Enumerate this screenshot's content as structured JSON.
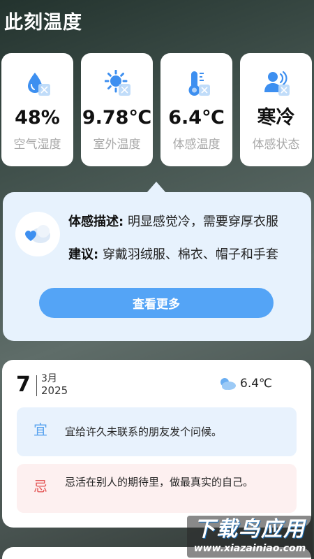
{
  "page_title": "此刻温度",
  "stats": [
    {
      "value": "48%",
      "label": "空气湿度",
      "icon": "humidity-icon"
    },
    {
      "value": "9.78℃",
      "label": "室外温度",
      "icon": "sun-icon"
    },
    {
      "value": "6.4℃",
      "label": "体感温度",
      "icon": "thermometer-icon"
    },
    {
      "value": "寒冷",
      "label": "体感状态",
      "icon": "person-status-icon"
    }
  ],
  "feel": {
    "desc_label": "体感描述:",
    "desc_text": "明显感觉冷，需要穿厚衣服",
    "advice_label": "建议:",
    "advice_text": "穿戴羽绒服、棉衣、帽子和手套",
    "more_label": "查看更多"
  },
  "almanac": {
    "day": "7",
    "month": "3月",
    "year": "2025",
    "temp": "6.4℃",
    "yi_tag": "宜",
    "yi_text": "宜给许久未联系的朋友发个问候。",
    "ji_tag": "忌",
    "ji_text": "忌活在别人的期待里，做最真实的自己。"
  },
  "watermark": {
    "main": "下载鸟应用",
    "sub": "www.xiazainiao.com"
  },
  "colors": {
    "accent": "#54a4f6",
    "panel_bg": "#e7f2fd",
    "yi_color": "#58a3ef",
    "ji_color": "#e45a5a"
  }
}
